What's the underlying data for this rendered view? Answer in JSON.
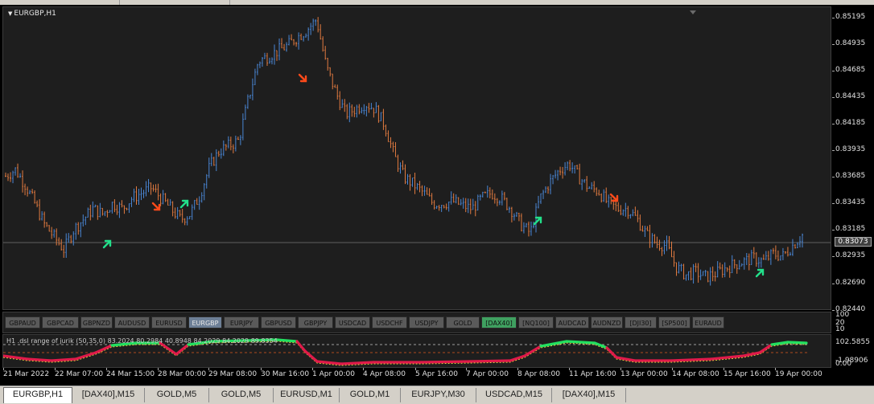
{
  "window": {
    "symbol_title": "EURGBP,H1",
    "indicator_label": "H1  .dsl range of jurik (50,35,0) 83.2024 80.2984 40.8948 84.2029 84.2029 89.8354",
    "current_price": "0.83073"
  },
  "price_axis": {
    "labels": [
      "0.85195",
      "0.84935",
      "0.84685",
      "0.84435",
      "0.84185",
      "0.83935",
      "0.83685",
      "0.83435",
      "0.83185",
      "0.82935",
      "0.82690",
      "0.82440"
    ]
  },
  "bar_axis": {
    "labels": [
      "100",
      "20",
      "10"
    ]
  },
  "indicator_axis": {
    "labels": [
      "102.5855",
      "0.00",
      "-1.98906"
    ]
  },
  "time_axis": {
    "labels": [
      "21 Mar 2022",
      "22 Mar 07:00",
      "24 Mar 15:00",
      "28 Mar 00:00",
      "29 Mar 08:00",
      "30 Mar 16:00",
      "1 Apr 00:00",
      "4 Apr 08:00",
      "5 Apr 16:00",
      "7 Apr 00:00",
      "8 Apr 08:00",
      "11 Apr 16:00",
      "13 Apr 00:00",
      "14 Apr 08:00",
      "15 Apr 16:00",
      "19 Apr 00:00"
    ]
  },
  "symbol_buttons": [
    "GBPAUD",
    "GBPCAD",
    "GBPNZD",
    "AUDUSD",
    "EURUSD",
    "EURGBP",
    "EURJPY",
    "GBPUSD",
    "GBPJPY",
    "USDCAD",
    "USDCHF",
    "USDJPY",
    "GOLD",
    "[DAX40]",
    "[NQ100]",
    "AUDCAD",
    "AUDNZD",
    "[DJI30]",
    "[SP500]",
    "EURAUD"
  ],
  "active_symbol": "EURGBP",
  "highlight_symbol": "[DAX40]",
  "tabs": [
    "EURGBP,H1",
    "[DAX40],M15",
    "GOLD,M5",
    "GOLD,M5",
    "EURUSD,M1",
    "GOLD,M1",
    "EURJPY,M30",
    "USDCAD,M15",
    "[DAX40],M15"
  ],
  "active_tab": 0,
  "colors": {
    "background": "#1e1e1e",
    "bull_bar": "#4a86d4",
    "bear_bar": "#e07a40",
    "buy_arrow": "#22e08a",
    "sell_arrow": "#ff4a1a",
    "indicator_up": "#22e060",
    "indicator_down": "#e01a4a",
    "indicator_signal": "#f0e040"
  },
  "chart_data": {
    "type": "ohlc",
    "symbol": "EURGBP",
    "timeframe": "H1",
    "ylim": [
      0.8244,
      0.8522
    ],
    "series_close": [
      0.8366,
      0.8372,
      0.8358,
      0.834,
      0.832,
      0.8308,
      0.8296,
      0.8315,
      0.8325,
      0.8335,
      0.833,
      0.834,
      0.8335,
      0.8345,
      0.835,
      0.8355,
      0.8345,
      0.8335,
      0.8325,
      0.833,
      0.8348,
      0.8375,
      0.839,
      0.8395,
      0.84,
      0.844,
      0.8475,
      0.848,
      0.8485,
      0.849,
      0.8498,
      0.8505,
      0.8515,
      0.847,
      0.8445,
      0.8425,
      0.843,
      0.8435,
      0.843,
      0.8415,
      0.8385,
      0.8365,
      0.8358,
      0.835,
      0.834,
      0.834,
      0.8342,
      0.8338,
      0.8335,
      0.8345,
      0.835,
      0.8345,
      0.8335,
      0.832,
      0.8312,
      0.8345,
      0.836,
      0.8372,
      0.8378,
      0.8365,
      0.8355,
      0.8352,
      0.834,
      0.8335,
      0.8335,
      0.8325,
      0.831,
      0.8302,
      0.83,
      0.828,
      0.8272,
      0.8275,
      0.827,
      0.8273,
      0.8278,
      0.8282,
      0.8285,
      0.8288,
      0.8285,
      0.8292,
      0.829,
      0.83,
      0.831
    ]
  }
}
